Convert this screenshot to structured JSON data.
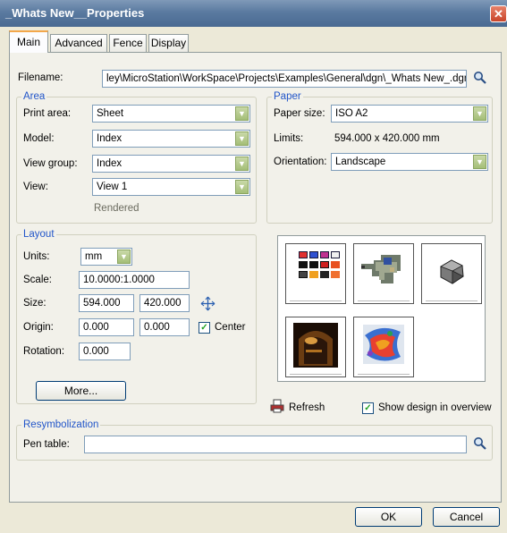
{
  "window": {
    "title": "_Whats New__Properties",
    "close_glyph": "✕"
  },
  "tabs": [
    "Main",
    "Advanced",
    "Fence",
    "Display"
  ],
  "filename": {
    "label": "Filename:",
    "value": "ley\\MicroStation\\WorkSpace\\Projects\\Examples\\General\\dgn\\_Whats New_.dgn"
  },
  "area": {
    "legend": "Area",
    "print_area": {
      "label": "Print area:",
      "value": "Sheet"
    },
    "model": {
      "label": "Model:",
      "value": "Index"
    },
    "view_group": {
      "label": "View group:",
      "value": "Index"
    },
    "view": {
      "label": "View:",
      "value": "View 1"
    },
    "rendered": "Rendered"
  },
  "paper": {
    "legend": "Paper",
    "size": {
      "label": "Paper size:",
      "value": "ISO A2"
    },
    "limits": {
      "label": "Limits:",
      "value": "594.000 x 420.000 mm"
    },
    "orientation": {
      "label": "Orientation:",
      "value": "Landscape"
    }
  },
  "layout": {
    "legend": "Layout",
    "units": {
      "label": "Units:",
      "value": "mm"
    },
    "scale": {
      "label": "Scale:",
      "value": "10.0000:1.0000"
    },
    "size": {
      "label": "Size:",
      "width": "594.000",
      "height": "420.000"
    },
    "origin": {
      "label": "Origin:",
      "x": "0.000",
      "y": "0.000",
      "center_label": "Center",
      "center_checked": true
    },
    "rotation": {
      "label": "Rotation:",
      "value": "0.000"
    },
    "more_button": "More..."
  },
  "preview": {
    "refresh_label": "Refresh",
    "show_design_label": "Show design in overview",
    "show_design_checked": true
  },
  "resymbolization": {
    "legend": "Resymbolization",
    "pen_table_label": "Pen table:",
    "pen_table_value": ""
  },
  "footer": {
    "ok": "OK",
    "cancel": "Cancel"
  },
  "icons": {
    "search": "search-icon",
    "dropdown": "chevron-down-icon",
    "refresh": "printer-icon",
    "maximize": "maximize-icon"
  },
  "colors": {
    "titlebar": "#5a7aa0",
    "legend": "#2155c9",
    "active_tab": "#f3a74a",
    "dialog": "#ece9d8"
  }
}
